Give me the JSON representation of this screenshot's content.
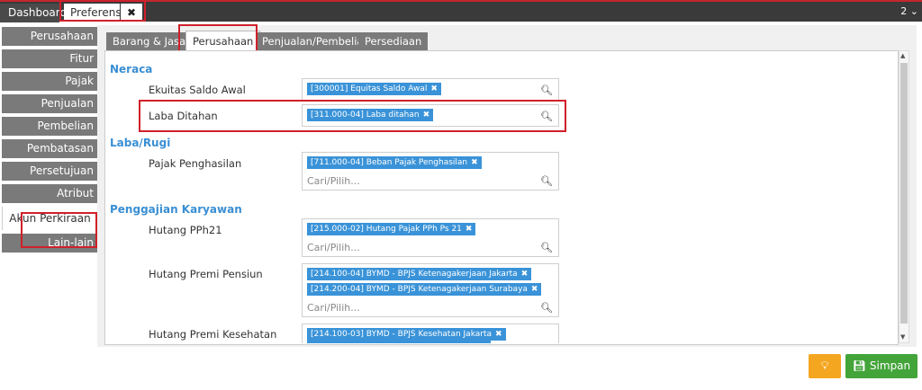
{
  "tabs": {
    "dashboard": "Dashboard",
    "preferensi": "Preferensi",
    "close": "✖",
    "top_right": "2 ⌄"
  },
  "sidebar": {
    "items": [
      {
        "label": "Perusahaan"
      },
      {
        "label": "Fitur"
      },
      {
        "label": "Pajak"
      },
      {
        "label": "Penjualan"
      },
      {
        "label": "Pembelian"
      },
      {
        "label": "Pembatasan"
      },
      {
        "label": "Persetujuan"
      },
      {
        "label": "Atribut Tambahan"
      },
      {
        "label": "Akun Perkiraan"
      },
      {
        "label": "Lain-lain"
      }
    ],
    "active_index": 8
  },
  "panel_tabs": [
    {
      "label": "Barang & Jasa"
    },
    {
      "label": "Perusahaan"
    },
    {
      "label": "Penjualan/Pembelian"
    },
    {
      "label": "Persediaan"
    }
  ],
  "sections": {
    "neraca": "Neraca",
    "laba_rugi": "Laba/Rugi",
    "penggajian": "Penggajian Karyawan"
  },
  "fields": {
    "ekuitas": {
      "label": "Ekuitas Saldo Awal",
      "chips": [
        "[300001] Equitas Saldo Awal"
      ]
    },
    "laba_ditahan": {
      "label": "Laba Ditahan",
      "chips": [
        "[311.000-04] Laba ditahan"
      ]
    },
    "pajak_penghasilan": {
      "label": "Pajak Penghasilan",
      "chips": [
        "[711.000-04] Beban Pajak Penghasilan"
      ],
      "placeholder": "Cari/Pilih..."
    },
    "hutang_pph21": {
      "label": "Hutang PPh21",
      "chips": [
        "[215.000-02] Hutang Pajak PPh Ps 21"
      ],
      "placeholder": "Cari/Pilih..."
    },
    "hutang_premi_pensiun": {
      "label": "Hutang Premi Pensiun",
      "chips": [
        "[214.100-04] BYMD - BPJS Ketenagakerjaan Jakarta",
        "[214.200-04] BYMD - BPJS Ketenagakerjaan Surabaya"
      ],
      "placeholder": "Cari/Pilih..."
    },
    "hutang_premi_kesehatan": {
      "label": "Hutang Premi Kesehatan",
      "chips": [
        "[214.100-03] BYMD - BPJS Kesehatan Jakarta"
      ]
    }
  },
  "icons": {
    "search": "search-icon",
    "remove": "remove-chip-icon",
    "bulb": "lightbulb-icon",
    "save": "save-icon"
  },
  "buttons": {
    "save_label": "Simpan"
  },
  "colors": {
    "highlight": "#d0202a",
    "section_blue": "#3a8fd4",
    "chip_blue": "#3a93d8",
    "save_green": "#43a43a",
    "bulb_orange": "#f4a621"
  }
}
